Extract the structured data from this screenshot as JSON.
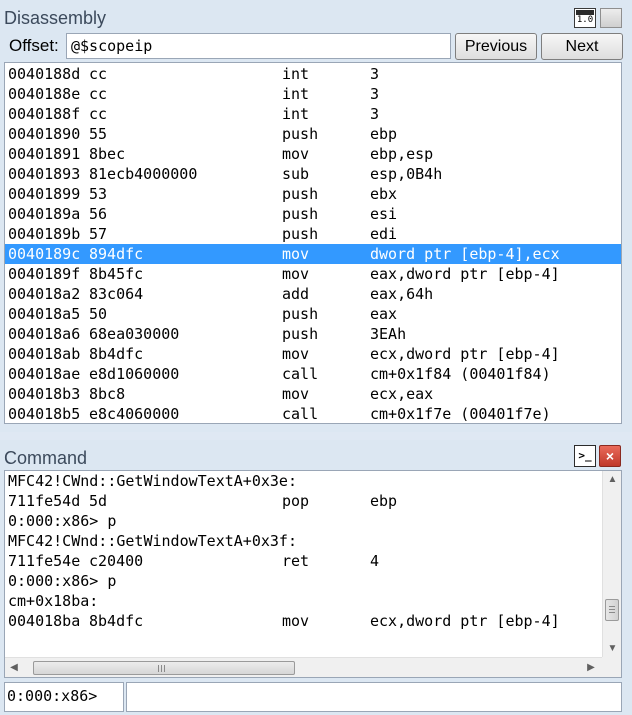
{
  "disassembly": {
    "title": "Disassembly",
    "offset_label": "Offset:",
    "offset_value": "@$scopeip",
    "previous_label": "Previous",
    "next_label": "Next",
    "icon_label": "1.0",
    "rows": [
      {
        "addr": "0040188d",
        "bytes": "cc",
        "mnemonic": "int",
        "operands": "3"
      },
      {
        "addr": "0040188e",
        "bytes": "cc",
        "mnemonic": "int",
        "operands": "3"
      },
      {
        "addr": "0040188f",
        "bytes": "cc",
        "mnemonic": "int",
        "operands": "3"
      },
      {
        "addr": "00401890",
        "bytes": "55",
        "mnemonic": "push",
        "operands": "ebp"
      },
      {
        "addr": "00401891",
        "bytes": "8bec",
        "mnemonic": "mov",
        "operands": "ebp,esp"
      },
      {
        "addr": "00401893",
        "bytes": "81ecb4000000",
        "mnemonic": "sub",
        "operands": "esp,0B4h"
      },
      {
        "addr": "00401899",
        "bytes": "53",
        "mnemonic": "push",
        "operands": "ebx"
      },
      {
        "addr": "0040189a",
        "bytes": "56",
        "mnemonic": "push",
        "operands": "esi"
      },
      {
        "addr": "0040189b",
        "bytes": "57",
        "mnemonic": "push",
        "operands": "edi"
      },
      {
        "addr": "0040189c",
        "bytes": "894dfc",
        "mnemonic": "mov",
        "operands": "dword ptr [ebp-4],ecx",
        "selected": true
      },
      {
        "addr": "0040189f",
        "bytes": "8b45fc",
        "mnemonic": "mov",
        "operands": "eax,dword ptr [ebp-4]"
      },
      {
        "addr": "004018a2",
        "bytes": "83c064",
        "mnemonic": "add",
        "operands": "eax,64h"
      },
      {
        "addr": "004018a5",
        "bytes": "50",
        "mnemonic": "push",
        "operands": "eax"
      },
      {
        "addr": "004018a6",
        "bytes": "68ea030000",
        "mnemonic": "push",
        "operands": "3EAh"
      },
      {
        "addr": "004018ab",
        "bytes": "8b4dfc",
        "mnemonic": "mov",
        "operands": "ecx,dword ptr [ebp-4]"
      },
      {
        "addr": "004018ae",
        "bytes": "e8d1060000",
        "mnemonic": "call",
        "operands": "cm+0x1f84 (00401f84)"
      },
      {
        "addr": "004018b3",
        "bytes": "8bc8",
        "mnemonic": "mov",
        "operands": "ecx,eax"
      },
      {
        "addr": "004018b5",
        "bytes": "e8c4060000",
        "mnemonic": "call",
        "operands": "cm+0x1f7e (00401f7e)"
      }
    ]
  },
  "command": {
    "title": "Command",
    "icon_label": ">_",
    "close_label": "×",
    "prompt": "0:000:x86>",
    "input_value": "",
    "lines": [
      {
        "text": "MFC42!CWnd::GetWindowTextA+0x3e:"
      },
      {
        "addr": "711fe54d",
        "bytes": "5d",
        "mnemonic": "pop",
        "operands": "ebp"
      },
      {
        "text": "0:000:x86> p"
      },
      {
        "text": "MFC42!CWnd::GetWindowTextA+0x3f:"
      },
      {
        "addr": "711fe54e",
        "bytes": "c20400",
        "mnemonic": "ret",
        "operands": "4"
      },
      {
        "text": "0:000:x86> p"
      },
      {
        "text": "cm+0x18ba:"
      },
      {
        "addr": "004018ba",
        "bytes": "8b4dfc",
        "mnemonic": "mov",
        "operands": "ecx,dword ptr [ebp-4]"
      }
    ]
  }
}
